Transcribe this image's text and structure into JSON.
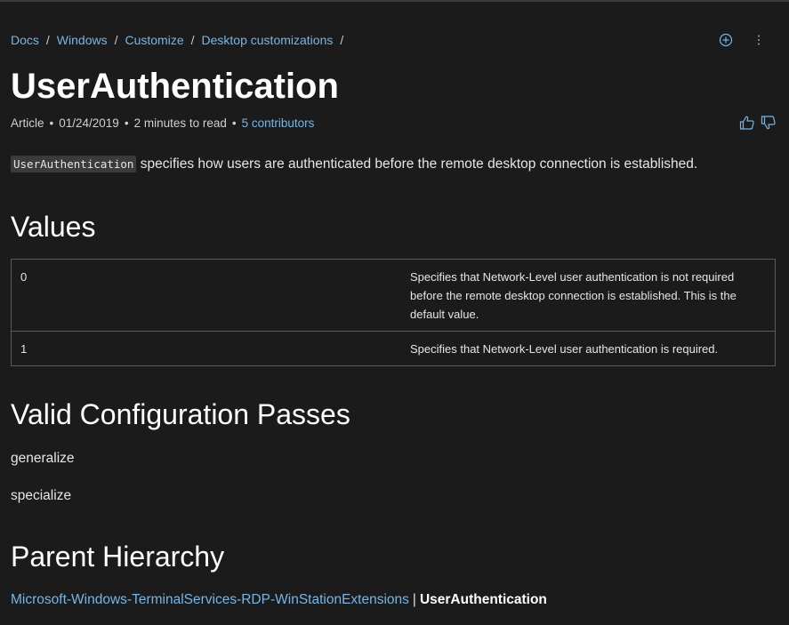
{
  "breadcrumb": {
    "items": [
      "Docs",
      "Windows",
      "Customize",
      "Desktop customizations"
    ],
    "separator": "/"
  },
  "actions": {
    "add_icon": "circle-plus-icon",
    "more_icon": "vertical-ellipsis-icon"
  },
  "article": {
    "title": "UserAuthentication",
    "meta": {
      "type": "Article",
      "date": "01/24/2019",
      "read_time": "2 minutes to read",
      "contributors": "5 contributors"
    },
    "feedback": {
      "like_icon": "thumbs-up-icon",
      "dislike_icon": "thumbs-down-icon"
    },
    "intro_code": "UserAuthentication",
    "intro_text": " specifies how users are authenticated before the remote desktop connection is established."
  },
  "values_section": {
    "heading": "Values",
    "rows": [
      {
        "value": "0",
        "description": "Specifies that Network-Level user authentication is not required before the remote desktop connection is established. This is the default value."
      },
      {
        "value": "1",
        "description": "Specifies that Network-Level user authentication is required."
      }
    ]
  },
  "passes_section": {
    "heading": "Valid Configuration Passes",
    "items": [
      "generalize",
      "specialize"
    ]
  },
  "parent_section": {
    "heading": "Parent Hierarchy",
    "parent_link": "Microsoft-Windows-TerminalServices-RDP-WinStationExtensions",
    "separator": "|",
    "current": "UserAuthentication"
  },
  "colors": {
    "background": "#1b1b1b",
    "link": "#75b6e7",
    "text": "#e6e6e6",
    "heading": "#ffffff"
  }
}
